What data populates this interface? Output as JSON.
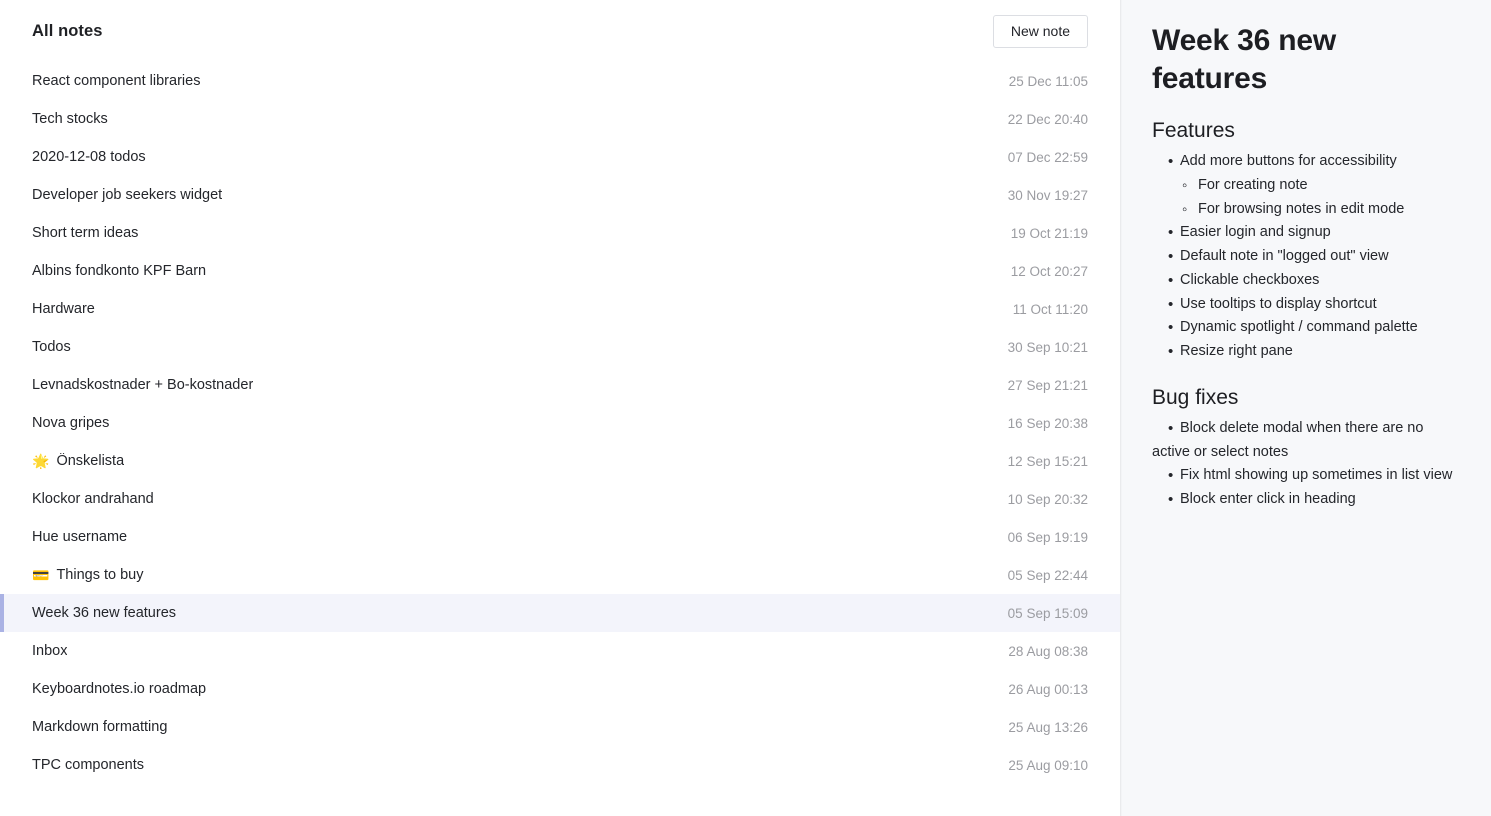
{
  "list_pane": {
    "header": {
      "title": "All notes",
      "new_note_label": "New note"
    },
    "notes": [
      {
        "emoji": "",
        "title": "React component libraries",
        "date": "25 Dec 11:05",
        "selected": false
      },
      {
        "emoji": "",
        "title": "Tech stocks",
        "date": "22 Dec 20:40",
        "selected": false
      },
      {
        "emoji": "",
        "title": "2020-12-08 todos",
        "date": "07 Dec 22:59",
        "selected": false
      },
      {
        "emoji": "",
        "title": "Developer job seekers widget",
        "date": "30 Nov 19:27",
        "selected": false
      },
      {
        "emoji": "",
        "title": "Short term ideas",
        "date": "19 Oct 21:19",
        "selected": false
      },
      {
        "emoji": "",
        "title": "Albins fondkonto KPF Barn",
        "date": "12 Oct 20:27",
        "selected": false
      },
      {
        "emoji": "",
        "title": "Hardware",
        "date": "11 Oct 11:20",
        "selected": false
      },
      {
        "emoji": "",
        "title": "Todos",
        "date": "30 Sep 10:21",
        "selected": false
      },
      {
        "emoji": "",
        "title": "Levnadskostnader + Bo-kostnader",
        "date": "27 Sep 21:21",
        "selected": false
      },
      {
        "emoji": "",
        "title": "Nova gripes",
        "date": "16 Sep 20:38",
        "selected": false
      },
      {
        "emoji": "🌟",
        "title": "Önskelista",
        "date": "12 Sep 15:21",
        "selected": false
      },
      {
        "emoji": "",
        "title": "Klockor andrahand",
        "date": "10 Sep 20:32",
        "selected": false
      },
      {
        "emoji": "",
        "title": "Hue username",
        "date": "06 Sep 19:19",
        "selected": false
      },
      {
        "emoji": "💳",
        "title": "Things to buy",
        "date": "05 Sep 22:44",
        "selected": false
      },
      {
        "emoji": "",
        "title": "Week 36 new features",
        "date": "05 Sep 15:09",
        "selected": true
      },
      {
        "emoji": "",
        "title": "Inbox",
        "date": "28 Aug 08:38",
        "selected": false
      },
      {
        "emoji": "",
        "title": "Keyboardnotes.io roadmap",
        "date": "26 Aug 00:13",
        "selected": false
      },
      {
        "emoji": "",
        "title": "Markdown formatting",
        "date": "25 Aug 13:26",
        "selected": false
      },
      {
        "emoji": "",
        "title": "TPC components",
        "date": "25 Aug 09:10",
        "selected": false
      }
    ]
  },
  "detail_pane": {
    "title": "Week 36 new features",
    "sections": [
      {
        "heading": "Features",
        "items": [
          {
            "level": 1,
            "text": "Add more buttons for accessibility"
          },
          {
            "level": 2,
            "text": "For creating note"
          },
          {
            "level": 2,
            "text": "For browsing notes in edit mode"
          },
          {
            "level": 1,
            "text": "Easier login and signup"
          },
          {
            "level": 1,
            "text": "Default note in \"logged out\" view"
          },
          {
            "level": 1,
            "text": "Clickable checkboxes"
          },
          {
            "level": 1,
            "text": "Use tooltips to display shortcut"
          },
          {
            "level": 1,
            "text": "Dynamic spotlight / command palette"
          },
          {
            "level": 1,
            "text": "Resize right pane"
          }
        ]
      },
      {
        "heading": "Bug fixes",
        "items": [
          {
            "level": 1,
            "text": "Block delete modal when there are no active or select notes"
          },
          {
            "level": 1,
            "text": "Fix html showing up sometimes in list view"
          },
          {
            "level": 1,
            "text": "Block enter click in heading"
          }
        ]
      }
    ]
  },
  "colors": {
    "selected_row_bg": "#f3f4fb",
    "selected_row_accent": "#aab2e4",
    "detail_pane_bg": "#f7f8fa",
    "date_text": "#9b9ca1",
    "body_text": "#24262b",
    "button_border": "#dcdee3"
  }
}
